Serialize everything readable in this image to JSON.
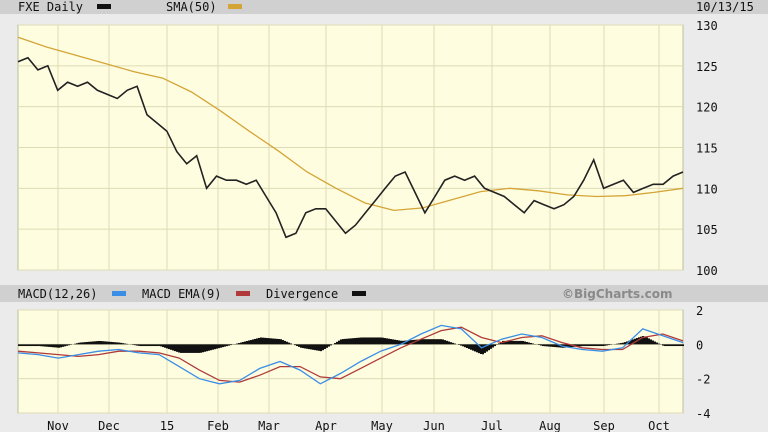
{
  "chart_data": [
    {
      "type": "line",
      "title": "FXE Daily",
      "date": "10/13/15",
      "legend": [
        {
          "name": "FXE Daily",
          "color": "#111111"
        },
        {
          "name": "SMA(50)",
          "color": "#d4a437"
        }
      ],
      "ylim": [
        100,
        130
      ],
      "yticks": [
        130,
        125,
        120,
        115,
        110,
        105,
        100
      ],
      "series": [
        {
          "name": "FXE Daily",
          "values": [
            125.5,
            126,
            124.5,
            125,
            122,
            123,
            122.5,
            123,
            122,
            121.5,
            121,
            122,
            122.5,
            119,
            118,
            117,
            114.5,
            113,
            114,
            110,
            111.5,
            111,
            111,
            110.5,
            111,
            109,
            107,
            104,
            104.5,
            107,
            107.5,
            107.5,
            106,
            104.5,
            105.5,
            107,
            108.5,
            110,
            111.5,
            112,
            109.5,
            107,
            109,
            111,
            111.5,
            111,
            111.5,
            110,
            109.5,
            109,
            108,
            107,
            108.5,
            108,
            107.5,
            108,
            109,
            111,
            113.5,
            110,
            110.5,
            111,
            109.5,
            110,
            110.5,
            110.5,
            111.5,
            112
          ]
        },
        {
          "name": "SMA(50)",
          "values": [
            128.5,
            127.3,
            126.3,
            125.3,
            124.3,
            123.5,
            121.8,
            119.5,
            117,
            114.6,
            112,
            110,
            108.2,
            107.3,
            107.6,
            108.6,
            109.6,
            110,
            109.7,
            109.2,
            109,
            109.1,
            109.5,
            110
          ]
        }
      ]
    },
    {
      "type": "line",
      "legend": [
        {
          "name": "MACD(12,26)",
          "color": "#3a8ee6"
        },
        {
          "name": "MACD EMA(9)",
          "color": "#b03a3a"
        },
        {
          "name": "Divergence",
          "color": "#111111"
        }
      ],
      "watermark": "©BigCharts.com",
      "ylim": [
        -4,
        2
      ],
      "yticks": [
        2,
        0,
        -2,
        -4
      ],
      "series": [
        {
          "name": "MACD(12,26)",
          "values": [
            -0.5,
            -0.6,
            -0.8,
            -0.6,
            -0.4,
            -0.3,
            -0.5,
            -0.6,
            -1.3,
            -2,
            -2.3,
            -2.1,
            -1.4,
            -1,
            -1.5,
            -2.3,
            -1.7,
            -1,
            -0.4,
            0,
            0.6,
            1.1,
            0.9,
            -0.2,
            0.3,
            0.6,
            0.4,
            -0.1,
            -0.3,
            -0.4,
            -0.2,
            0.9,
            0.5,
            0.1
          ]
        },
        {
          "name": "MACD EMA(9)",
          "values": [
            -0.4,
            -0.5,
            -0.6,
            -0.7,
            -0.6,
            -0.4,
            -0.4,
            -0.5,
            -0.8,
            -1.5,
            -2.1,
            -2.2,
            -1.8,
            -1.3,
            -1.3,
            -1.9,
            -2,
            -1.4,
            -0.8,
            -0.2,
            0.3,
            0.8,
            1.0,
            0.4,
            0.1,
            0.4,
            0.5,
            0.1,
            -0.2,
            -0.3,
            -0.3,
            0.4,
            0.6,
            0.2
          ]
        }
      ]
    }
  ],
  "xaxis": {
    "ticks": [
      "Nov",
      "Dec",
      "15",
      "Feb",
      "Mar",
      "Apr",
      "May",
      "Jun",
      "Jul",
      "Aug",
      "Sep",
      "Oct"
    ]
  }
}
